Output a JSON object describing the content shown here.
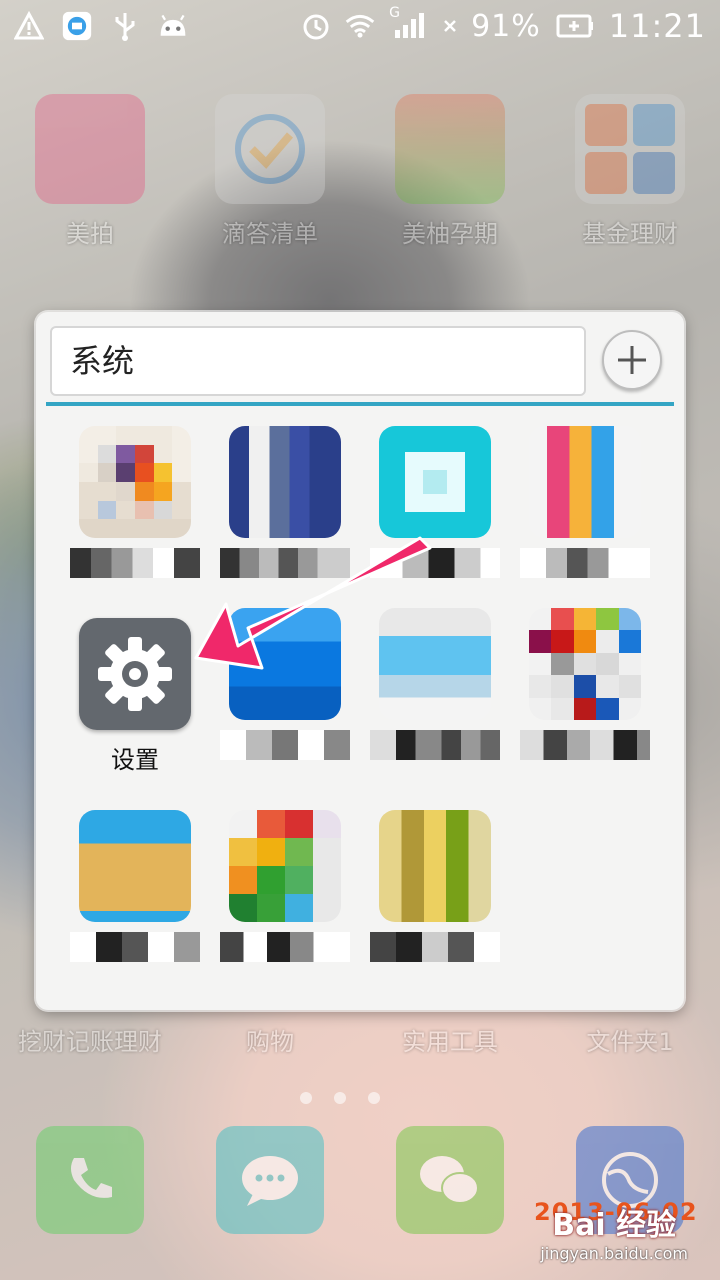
{
  "status_bar": {
    "battery_percent": "91%",
    "time": "11:21",
    "network_type": "G",
    "icons": [
      "warning-icon",
      "app-notification-icon",
      "usb-icon",
      "android-debug-icon",
      "alarm-icon",
      "wifi-icon",
      "signal-icon",
      "battery-icon"
    ]
  },
  "background_apps": {
    "row1": [
      {
        "label": "美拍",
        "color": "#e94c7a"
      },
      {
        "label": "滴答清单",
        "color": "#c9c9c9"
      },
      {
        "label": "美柚孕期",
        "color": "#e86a4a"
      },
      {
        "label": "基金理财",
        "color": "#d0d0d0"
      }
    ],
    "row2": [
      {
        "label": "挖财记账理财"
      },
      {
        "label": "购物"
      },
      {
        "label": "实用工具"
      },
      {
        "label": "文件夹1"
      }
    ]
  },
  "folder": {
    "name": "系统",
    "add_button_icon": "plus-icon",
    "divider_color": "#34a5c4",
    "apps": [
      {
        "label": "",
        "pixelated": true
      },
      {
        "label": "",
        "pixelated": true
      },
      {
        "label": "",
        "pixelated": true
      },
      {
        "label": "",
        "pixelated": true
      },
      {
        "label": "设置",
        "pixelated": false,
        "icon": "gear-icon"
      },
      {
        "label": "",
        "pixelated": true
      },
      {
        "label": "",
        "pixelated": true
      },
      {
        "label": "",
        "pixelated": true
      },
      {
        "label": "",
        "pixelated": true
      },
      {
        "label": "",
        "pixelated": true
      },
      {
        "label": "",
        "pixelated": true
      }
    ]
  },
  "annotation": {
    "arrow_color": "#f0286a"
  },
  "dock": {
    "icons": [
      {
        "name": "phone-icon",
        "color": "#6bcf6b"
      },
      {
        "name": "messages-icon",
        "color": "#4cc1c4"
      },
      {
        "name": "wechat-icon",
        "color": "#7cc84e"
      },
      {
        "name": "browser-icon",
        "color": "#3c6fd0"
      }
    ]
  },
  "watermark": {
    "logo": "Bai 经验",
    "url": "jingyan.baidu.com",
    "date_stamp": "2013-06-02"
  }
}
